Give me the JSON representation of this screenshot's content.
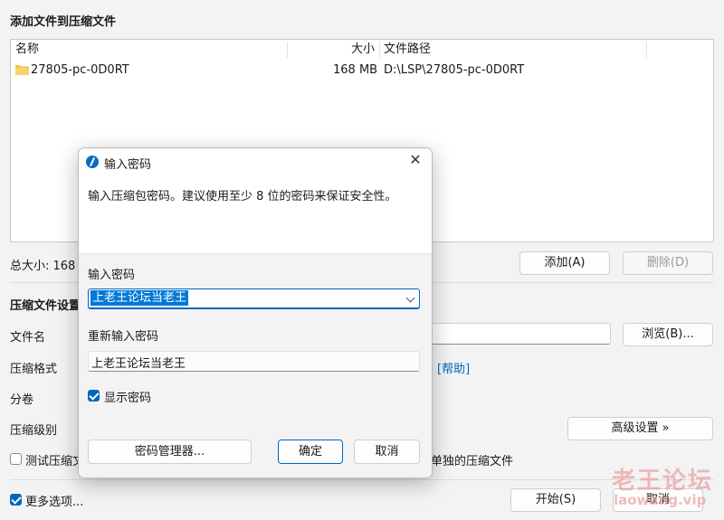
{
  "main": {
    "title": "添加文件到压缩文件",
    "list": {
      "columns": [
        "名称",
        "大小",
        "文件路径"
      ],
      "rows": [
        {
          "name": "27805-pc-0D0RT",
          "size": "168 MB",
          "path": "D:\\LSP\\27805-pc-0D0RT"
        }
      ]
    },
    "total_size_label": "总大小: 168 M",
    "add_button": "添加(A)",
    "delete_button": "删除(D)",
    "settings_title": "压缩文件设置",
    "filename_label": "文件名",
    "browse_button": "浏览(B)...",
    "format_label": "压缩格式",
    "help_link": "[帮助]",
    "split_label": "分卷",
    "level_label": "压缩级别",
    "advanced_button": "高级设置 »",
    "test_label": "测试压缩文",
    "separate_label": "单独的压缩文件",
    "more_options_label": "更多选项...",
    "start_button": "开始(S)",
    "cancel_button": "取消"
  },
  "dialog": {
    "title": "输入密码",
    "description": "输入压缩包密码。建议使用至少 8 位的密码来保证安全性。",
    "password_label": "输入密码",
    "password_value": "上老王论坛当老王",
    "reenter_label": "重新输入密码",
    "reenter_value": "上老王论坛当老王",
    "show_password_label": "显示密码",
    "show_password_checked": true,
    "manager_button": "密码管理器...",
    "ok_button": "确定",
    "cancel_button": "取消"
  },
  "watermark": {
    "line1": "老王论坛",
    "line2": "laowang.vip"
  }
}
